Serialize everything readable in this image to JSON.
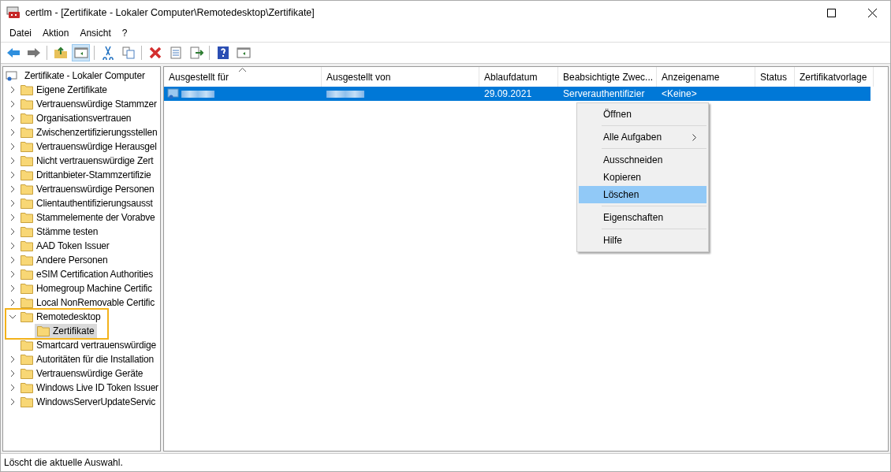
{
  "window": {
    "title": "certlm - [Zertifikate - Lokaler Computer\\Remotedesktop\\Zertifikate]"
  },
  "menu_bar": [
    "Datei",
    "Aktion",
    "Ansicht",
    "?"
  ],
  "toolbar": [
    {
      "kind": "back",
      "pressed": false
    },
    {
      "kind": "forward",
      "pressed": false
    },
    {
      "kind": "separator"
    },
    {
      "kind": "up",
      "pressed": false
    },
    {
      "kind": "tree",
      "pressed": true
    },
    {
      "kind": "separator"
    },
    {
      "kind": "cut",
      "pressed": false
    },
    {
      "kind": "copy",
      "pressed": false
    },
    {
      "kind": "separator"
    },
    {
      "kind": "delete",
      "pressed": false
    },
    {
      "kind": "properties",
      "pressed": false
    },
    {
      "kind": "export",
      "pressed": false
    },
    {
      "kind": "separator"
    },
    {
      "kind": "help",
      "pressed": false
    },
    {
      "kind": "pane",
      "pressed": false
    }
  ],
  "tree": {
    "root": "Zertifikate - Lokaler Computer",
    "items": [
      {
        "label": "Eigene Zertifikate",
        "expanded": false
      },
      {
        "label": "Vertrauenswürdige Stammzer",
        "expanded": false
      },
      {
        "label": "Organisationsvertrauen",
        "expanded": false
      },
      {
        "label": "Zwischenzertifizierungsstellen",
        "expanded": false
      },
      {
        "label": "Vertrauenswürdige Herausgel",
        "expanded": false
      },
      {
        "label": "Nicht vertrauenswürdige Zert",
        "expanded": false
      },
      {
        "label": "Drittanbieter-Stammzertifizie",
        "expanded": false
      },
      {
        "label": "Vertrauenswürdige Personen",
        "expanded": false
      },
      {
        "label": "Clientauthentifizierungsausst",
        "expanded": false
      },
      {
        "label": "Stammelemente der Vorabve",
        "expanded": false
      },
      {
        "label": "Stämme testen",
        "expanded": false
      },
      {
        "label": "AAD Token Issuer",
        "expanded": false
      },
      {
        "label": "Andere Personen",
        "expanded": false
      },
      {
        "label": "eSIM Certification Authorities",
        "expanded": false
      },
      {
        "label": "Homegroup Machine Certific",
        "expanded": false
      },
      {
        "label": "Local NonRemovable Certific",
        "expanded": false
      },
      {
        "label": "Remotedesktop",
        "expanded": true,
        "highlighted": true,
        "children": [
          {
            "label": "Zertifikate",
            "selected": true
          }
        ]
      },
      {
        "label": "Smartcard vertrauenswürdige"
      },
      {
        "label": "Autoritäten für die Installation",
        "expanded": false
      },
      {
        "label": "Vertrauenswürdige Geräte",
        "expanded": false
      },
      {
        "label": "Windows Live ID Token Issuer",
        "expanded": false
      },
      {
        "label": "WindowsServerUpdateServic",
        "expanded": false
      }
    ]
  },
  "table": {
    "columns": [
      {
        "label": "Ausgestellt für",
        "sorted": true
      },
      {
        "label": "Ausgestellt von",
        "sorted": false
      },
      {
        "label": "Ablaufdatum",
        "sorted": false
      },
      {
        "label": "Beabsichtigte Zwec...",
        "sorted": false
      },
      {
        "label": "Anzeigename",
        "sorted": false
      },
      {
        "label": "Status",
        "sorted": false
      },
      {
        "label": "Zertifikatvorlage",
        "sorted": false
      }
    ],
    "rows": [
      {
        "selected": true,
        "cells": [
          {
            "kind": "blurred"
          },
          {
            "kind": "blurred"
          },
          {
            "kind": "text",
            "text": "29.09.2021"
          },
          {
            "kind": "text",
            "text": "Serverauthentifizier"
          },
          {
            "kind": "text",
            "text": "<Keine>"
          },
          {
            "kind": "empty"
          },
          {
            "kind": "empty"
          }
        ]
      }
    ]
  },
  "context_menu": [
    {
      "kind": "item",
      "label": "Öffnen",
      "submenu": false,
      "selected": false
    },
    {
      "kind": "separator"
    },
    {
      "kind": "item",
      "label": "Alle Aufgaben",
      "submenu": true,
      "selected": false
    },
    {
      "kind": "separator"
    },
    {
      "kind": "item",
      "label": "Ausschneiden",
      "submenu": false,
      "selected": false
    },
    {
      "kind": "item",
      "label": "Kopieren",
      "submenu": false,
      "selected": false
    },
    {
      "kind": "item",
      "label": "Löschen",
      "submenu": false,
      "selected": true
    },
    {
      "kind": "separator"
    },
    {
      "kind": "item",
      "label": "Eigenschaften",
      "submenu": false,
      "selected": false
    },
    {
      "kind": "separator"
    },
    {
      "kind": "item",
      "label": "Hilfe",
      "submenu": false,
      "selected": false
    }
  ],
  "status_bar": "Löscht die aktuelle Auswahl."
}
